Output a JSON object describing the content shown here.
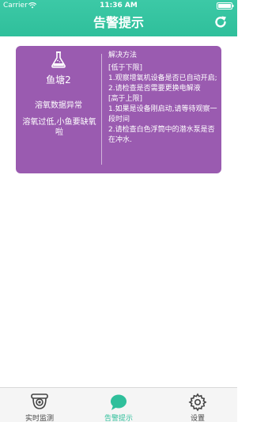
{
  "status_bar": {
    "carrier": "Carrier",
    "time": "11:36 AM"
  },
  "nav": {
    "title": "告警提示",
    "refresh_icon": "refresh-icon"
  },
  "colors": {
    "header": "#2fbf9b",
    "card": "#9a5bb0",
    "active_tab": "#2fbf9b"
  },
  "alert": {
    "icon": "flask-icon",
    "pond_name": "鱼塘2",
    "alert_type": "溶氧数据异常",
    "message": "溶氧过低,小鱼要缺氧啦",
    "solution_title": "解决方法",
    "solution_body": "[低于下限]\n1.观察增氧机设备是否已自动开启;\n2.请检查是否需要更换电解液\n[高于上限]\n1.如果是设备刚启动,请等待观察一段时间\n2.请检查白色浮筒中的潜水泵是否在冲水."
  },
  "tabs": [
    {
      "label": "实时监测",
      "icon": "camera-icon",
      "active": false
    },
    {
      "label": "告警提示",
      "icon": "chat-icon",
      "active": true
    },
    {
      "label": "设置",
      "icon": "gear-icon",
      "active": false
    }
  ]
}
